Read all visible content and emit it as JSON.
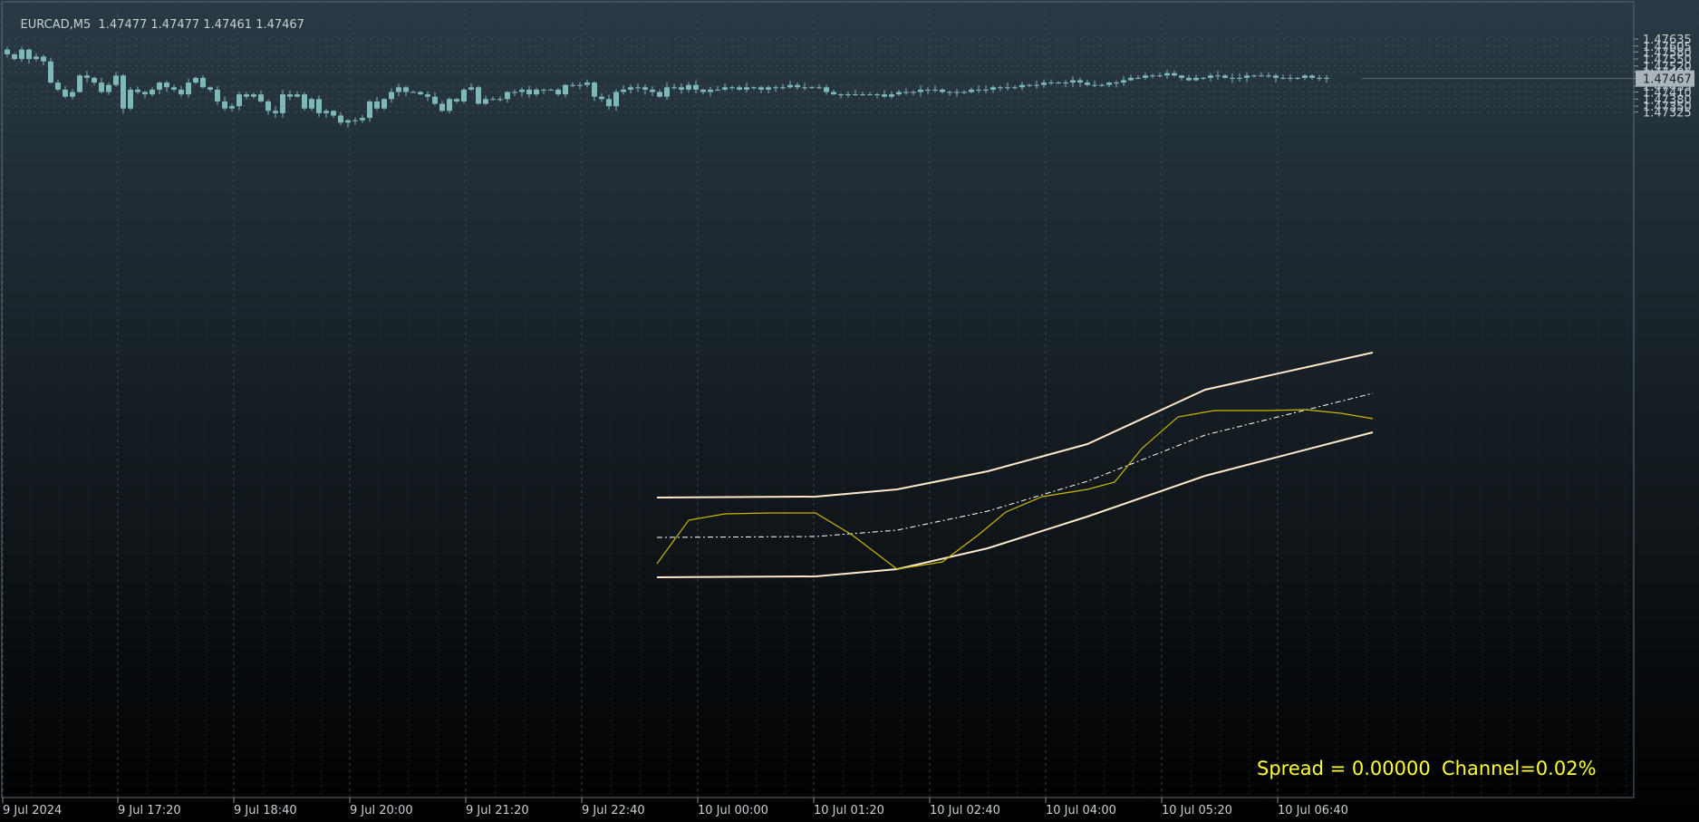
{
  "header": {
    "symbol": "EURCAD,M5",
    "ohlc": "1.47477 1.47477 1.47461 1.47467"
  },
  "info": {
    "spread_text": "Spread = 0.00000",
    "channel_text": "Channel=0.02%"
  },
  "colors": {
    "background_top": "#2a3a44",
    "background_bottom": "#000000",
    "candle": "#7fb8b8",
    "grid": "#3a4852",
    "axis_text": "#c8d0d4",
    "channel": "#ffe8cc",
    "middle_line": "#ffffff",
    "fit_curve": "#ccb800",
    "info_text": "#ffff33",
    "price_tag_bg": "#aab4ba"
  },
  "chart_data": {
    "type": "candlestick",
    "symbol": "EURCAD",
    "timeframe": "M5",
    "current_price": "1.47467",
    "ylim": [
      1.473,
      1.4766
    ],
    "y_ticks": [
      "1.47635",
      "1.47605",
      "1.47580",
      "1.47550",
      "1.47520",
      "1.47495",
      "1.47467",
      "1.47435",
      "1.47410",
      "1.47380",
      "1.47350",
      "1.47325"
    ],
    "x_ticks": [
      "9 Jul 2024",
      "9 Jul 17:20",
      "9 Jul 18:40",
      "9 Jul 20:00",
      "9 Jul 21:20",
      "9 Jul 22:40",
      "10 Jul 00:00",
      "10 Jul 01:20",
      "10 Jul 02:40",
      "10 Jul 04:00",
      "10 Jul 05:20",
      "10 Jul 06:40"
    ],
    "grid": true,
    "candles_count": 185,
    "closes": [
      1.4757,
      1.4755,
      1.4759,
      1.4755,
      1.4756,
      1.4754,
      1.4745,
      1.4742,
      1.4739,
      1.4741,
      1.4748,
      1.4747,
      1.4745,
      1.4741,
      1.4744,
      1.4748,
      1.4734,
      1.4742,
      1.4741,
      1.474,
      1.4742,
      1.4745,
      1.4743,
      1.4742,
      1.474,
      1.4745,
      1.4747,
      1.4743,
      1.4742,
      1.4737,
      1.4734,
      1.4735,
      1.474,
      1.4739,
      1.474,
      1.4737,
      1.4733,
      1.4732,
      1.474,
      1.4739,
      1.474,
      1.4734,
      1.4738,
      1.4732,
      1.4733,
      1.4731,
      1.4728,
      1.4729,
      1.4729,
      1.473,
      1.4737,
      1.4734,
      1.4738,
      1.4741,
      1.4743,
      1.4741,
      1.4741,
      1.474,
      1.4739,
      1.4736,
      1.4733,
      1.4738,
      1.4737,
      1.4742,
      1.4743,
      1.4736,
      1.4738,
      1.4738,
      1.4738,
      1.4741,
      1.4741,
      1.4742,
      1.474,
      1.4742,
      1.4742,
      1.4742,
      1.474,
      1.4744,
      1.4744,
      1.4744,
      1.4745,
      1.4739,
      1.4738,
      1.4735,
      1.4741,
      1.4742,
      1.4743,
      1.4743,
      1.4742,
      1.4741,
      1.4739,
      1.4743,
      1.4743,
      1.4742,
      1.4744,
      1.4742,
      1.4741,
      1.4742,
      1.4742,
      1.4743,
      1.4743,
      1.4742,
      1.4743,
      1.4743,
      1.4742,
      1.4743,
      1.4743,
      1.4743,
      1.4744,
      1.4743,
      1.4743,
      1.4743,
      1.4743,
      1.4741,
      1.474,
      1.474,
      1.474,
      1.474,
      1.474,
      1.474,
      1.474,
      1.4739,
      1.474,
      1.4741,
      1.4741,
      1.4741,
      1.4742,
      1.4742,
      1.4742,
      1.4741,
      1.4741,
      1.4741,
      1.4741,
      1.4742,
      1.4742,
      1.4742,
      1.4743,
      1.4743,
      1.4743,
      1.4743,
      1.4744,
      1.4744,
      1.4744,
      1.4745,
      1.4745,
      1.4745,
      1.4745,
      1.4746,
      1.4745,
      1.4744,
      1.4744,
      1.4744,
      1.4745,
      1.4745,
      1.4746,
      1.4747,
      1.4747,
      1.4748,
      1.4748,
      1.4748,
      1.4749,
      1.4748,
      1.4747,
      1.4746,
      1.4747,
      1.4747,
      1.4748,
      1.4748,
      1.4747,
      1.4747,
      1.4747,
      1.4748,
      1.4748,
      1.4748,
      1.4748,
      1.4747,
      1.4747,
      1.4747,
      1.4747,
      1.4748,
      1.4747,
      1.4747,
      1.4747
    ]
  }
}
